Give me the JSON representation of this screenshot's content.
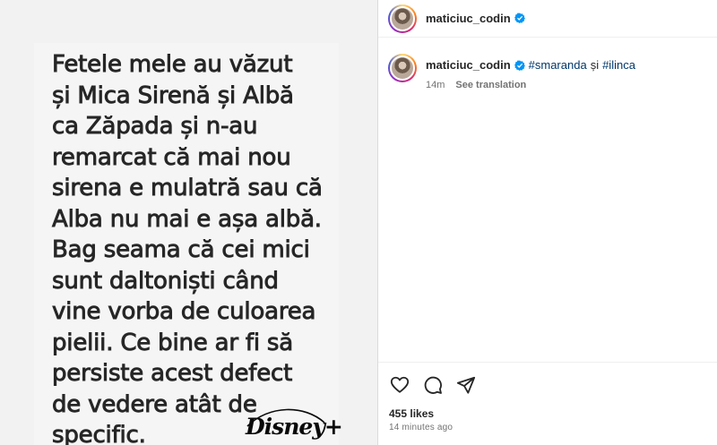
{
  "post": {
    "image_text": "Fetele mele au văzut\nși Mica Sirenă și Albă\nca Zăpada și n-au\nremarcat că mai nou\nsirena e mulatră sau că\nAlba nu mai e așa albă.\nBag seama că cei mici\nsunt daltoniști când\nvine vorba de culoarea\npielii.  Ce bine ar fi să\npersiste acest defect\nde vedere atât de\nspecific.",
    "brand_logo": "Disney+"
  },
  "header": {
    "username": "maticiuc_codin",
    "verified_icon": "verified-badge-icon"
  },
  "caption": {
    "username": "maticiuc_codin",
    "hashtag1": "#smaranda",
    "connector": "și",
    "hashtag2": "#ilinca",
    "time": "14m",
    "see_translation": "See translation"
  },
  "actions": {
    "like_icon": "heart-icon",
    "comment_icon": "comment-icon",
    "share_icon": "paper-plane-icon"
  },
  "stats": {
    "likes": "455 likes",
    "time_ago": "14 minutes ago"
  },
  "colors": {
    "verified": "#0095f6",
    "hashtag": "#00376b",
    "muted": "#737373",
    "text": "#262626"
  }
}
